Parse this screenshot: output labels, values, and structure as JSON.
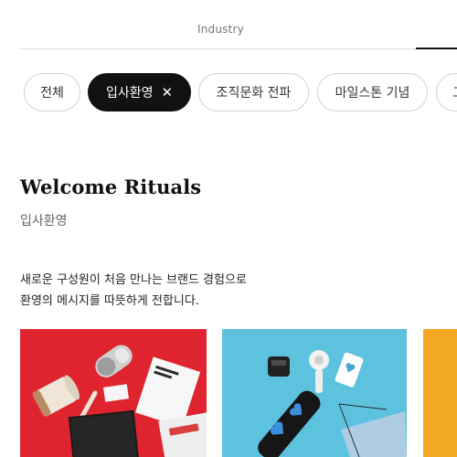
{
  "top_tabs": {
    "active_label": "Industry"
  },
  "filters": {
    "chips": [
      {
        "label": "전체",
        "active": false
      },
      {
        "label": "입사환영",
        "active": true,
        "close_symbol": "✕"
      },
      {
        "label": "조직문화 전파",
        "active": false
      },
      {
        "label": "마일스톤 기념",
        "active": false
      },
      {
        "label": "고",
        "active": false
      }
    ]
  },
  "section": {
    "title": "Welcome Rituals",
    "subtitle": "입사환영",
    "description_line1": "새로운 구성원이 처음 만나는 브랜드 경험으로",
    "description_line2": "환영의 메시지를 따뜻하게 전합니다."
  },
  "cards": [
    {
      "background": "#e0242f",
      "theme": "red welcome kit flat-lay"
    },
    {
      "background": "#5cc2de",
      "theme": "blue welcome kit flat-lay"
    },
    {
      "background": "#f3a823",
      "theme": "yellow kit (partially visible)"
    }
  ],
  "colors": {
    "chip_active_bg": "#111111",
    "chip_border": "#d2d2d2",
    "tab_underline": "#111111"
  }
}
